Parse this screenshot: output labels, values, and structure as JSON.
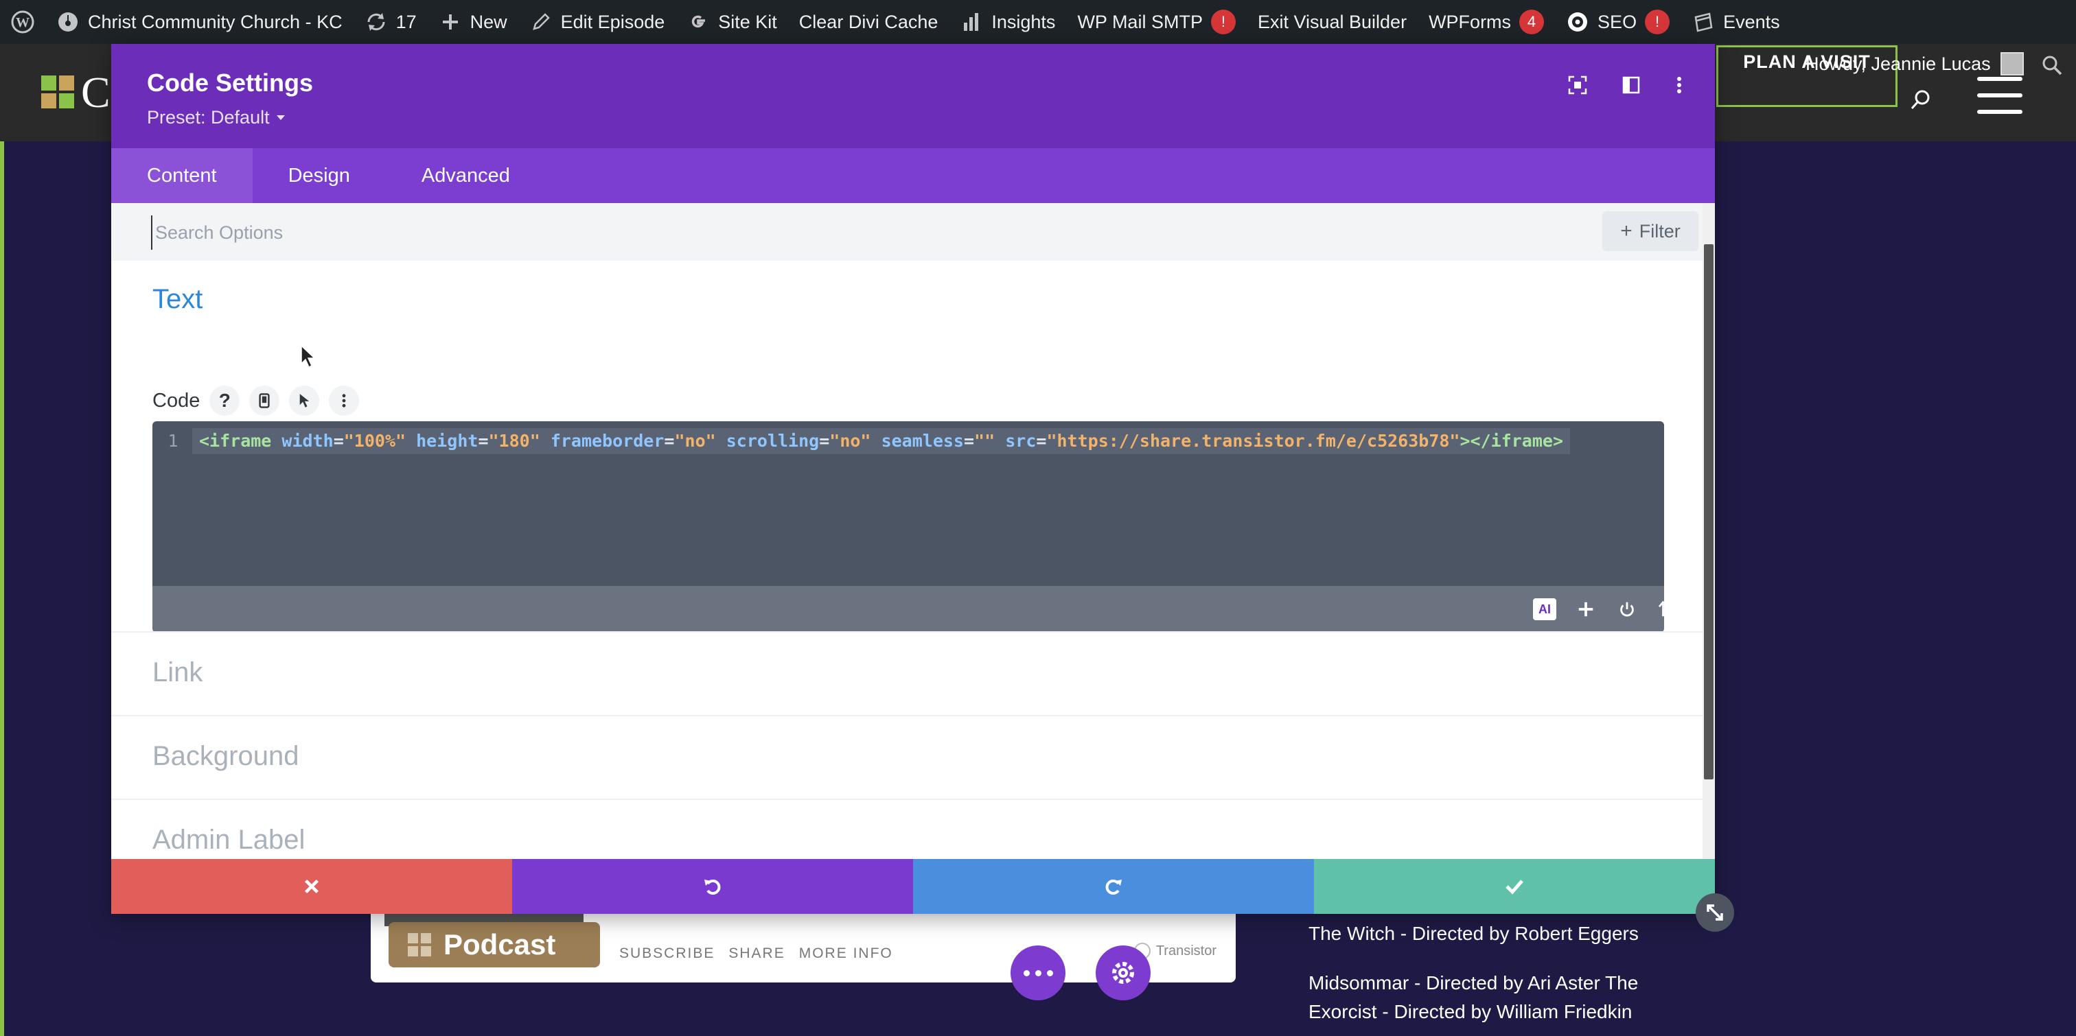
{
  "admin_bar": {
    "site_name": "Christ Community Church - KC",
    "updates_count": "17",
    "new_label": "New",
    "edit_label": "Edit Episode",
    "sitekit_label": "Site Kit",
    "clear_cache_label": "Clear Divi Cache",
    "insights_label": "Insights",
    "wpmail_label": "WP Mail SMTP",
    "wpmail_badge": "!",
    "exit_vb_label": "Exit Visual Builder",
    "wpforms_label": "WPForms",
    "wpforms_badge": "4",
    "seo_label": "SEO",
    "seo_badge": "!",
    "events_label": "Events",
    "howdy": "Howdy, Jeannie Lucas"
  },
  "site": {
    "logo_letter": "C",
    "plan_visit": "PLAN A VISIT"
  },
  "modal": {
    "title": "Code Settings",
    "preset": "Preset: Default",
    "tabs": [
      {
        "label": "Content"
      },
      {
        "label": "Design"
      },
      {
        "label": "Advanced"
      }
    ],
    "search": {
      "placeholder": "Search Options",
      "filter_label": "Filter"
    },
    "text_section": {
      "title": "Text",
      "code_label": "Code",
      "help_symbol": "?",
      "line_number": "1",
      "code_tokens": {
        "open": "<iframe",
        "a1": "width",
        "v1": "\"100%\"",
        "a2": "height",
        "v2": "\"180\"",
        "a3": "frameborder",
        "v3": "\"no\"",
        "a4": "scrolling",
        "v4": "\"no\"",
        "a5": "seamless",
        "v5": "\"\"",
        "a6": "src",
        "v6": "\"https://share.transistor.fm/e/c5263b78\"",
        "close": "></iframe>"
      },
      "ai_label": "AI"
    },
    "sections": [
      {
        "title": "Link"
      },
      {
        "title": "Background"
      },
      {
        "title": "Admin Label"
      }
    ]
  },
  "page": {
    "podcast_button": "Podcast",
    "podcast_links": [
      "SUBSCRIBE",
      "SHARE",
      "MORE INFO"
    ],
    "transistor_label": "Transistor",
    "movies": [
      "The Witch - Directed by Robert Eggers",
      "Midsommar - Directed by Ari Aster The Exorcist - Directed by William Friedkin"
    ]
  },
  "colors": {
    "admin_bar": "#1d2327",
    "modal_header": "#6c2eb9",
    "tabs_bar": "#7b3ed1",
    "section_title_active": "#2b87da",
    "cancel": "#e15e5b",
    "undo": "#7a3ad0",
    "redo": "#4a8ede",
    "save": "#5fc2a8",
    "page_background": "#1e1a45",
    "accent_green": "#8bc34a"
  }
}
